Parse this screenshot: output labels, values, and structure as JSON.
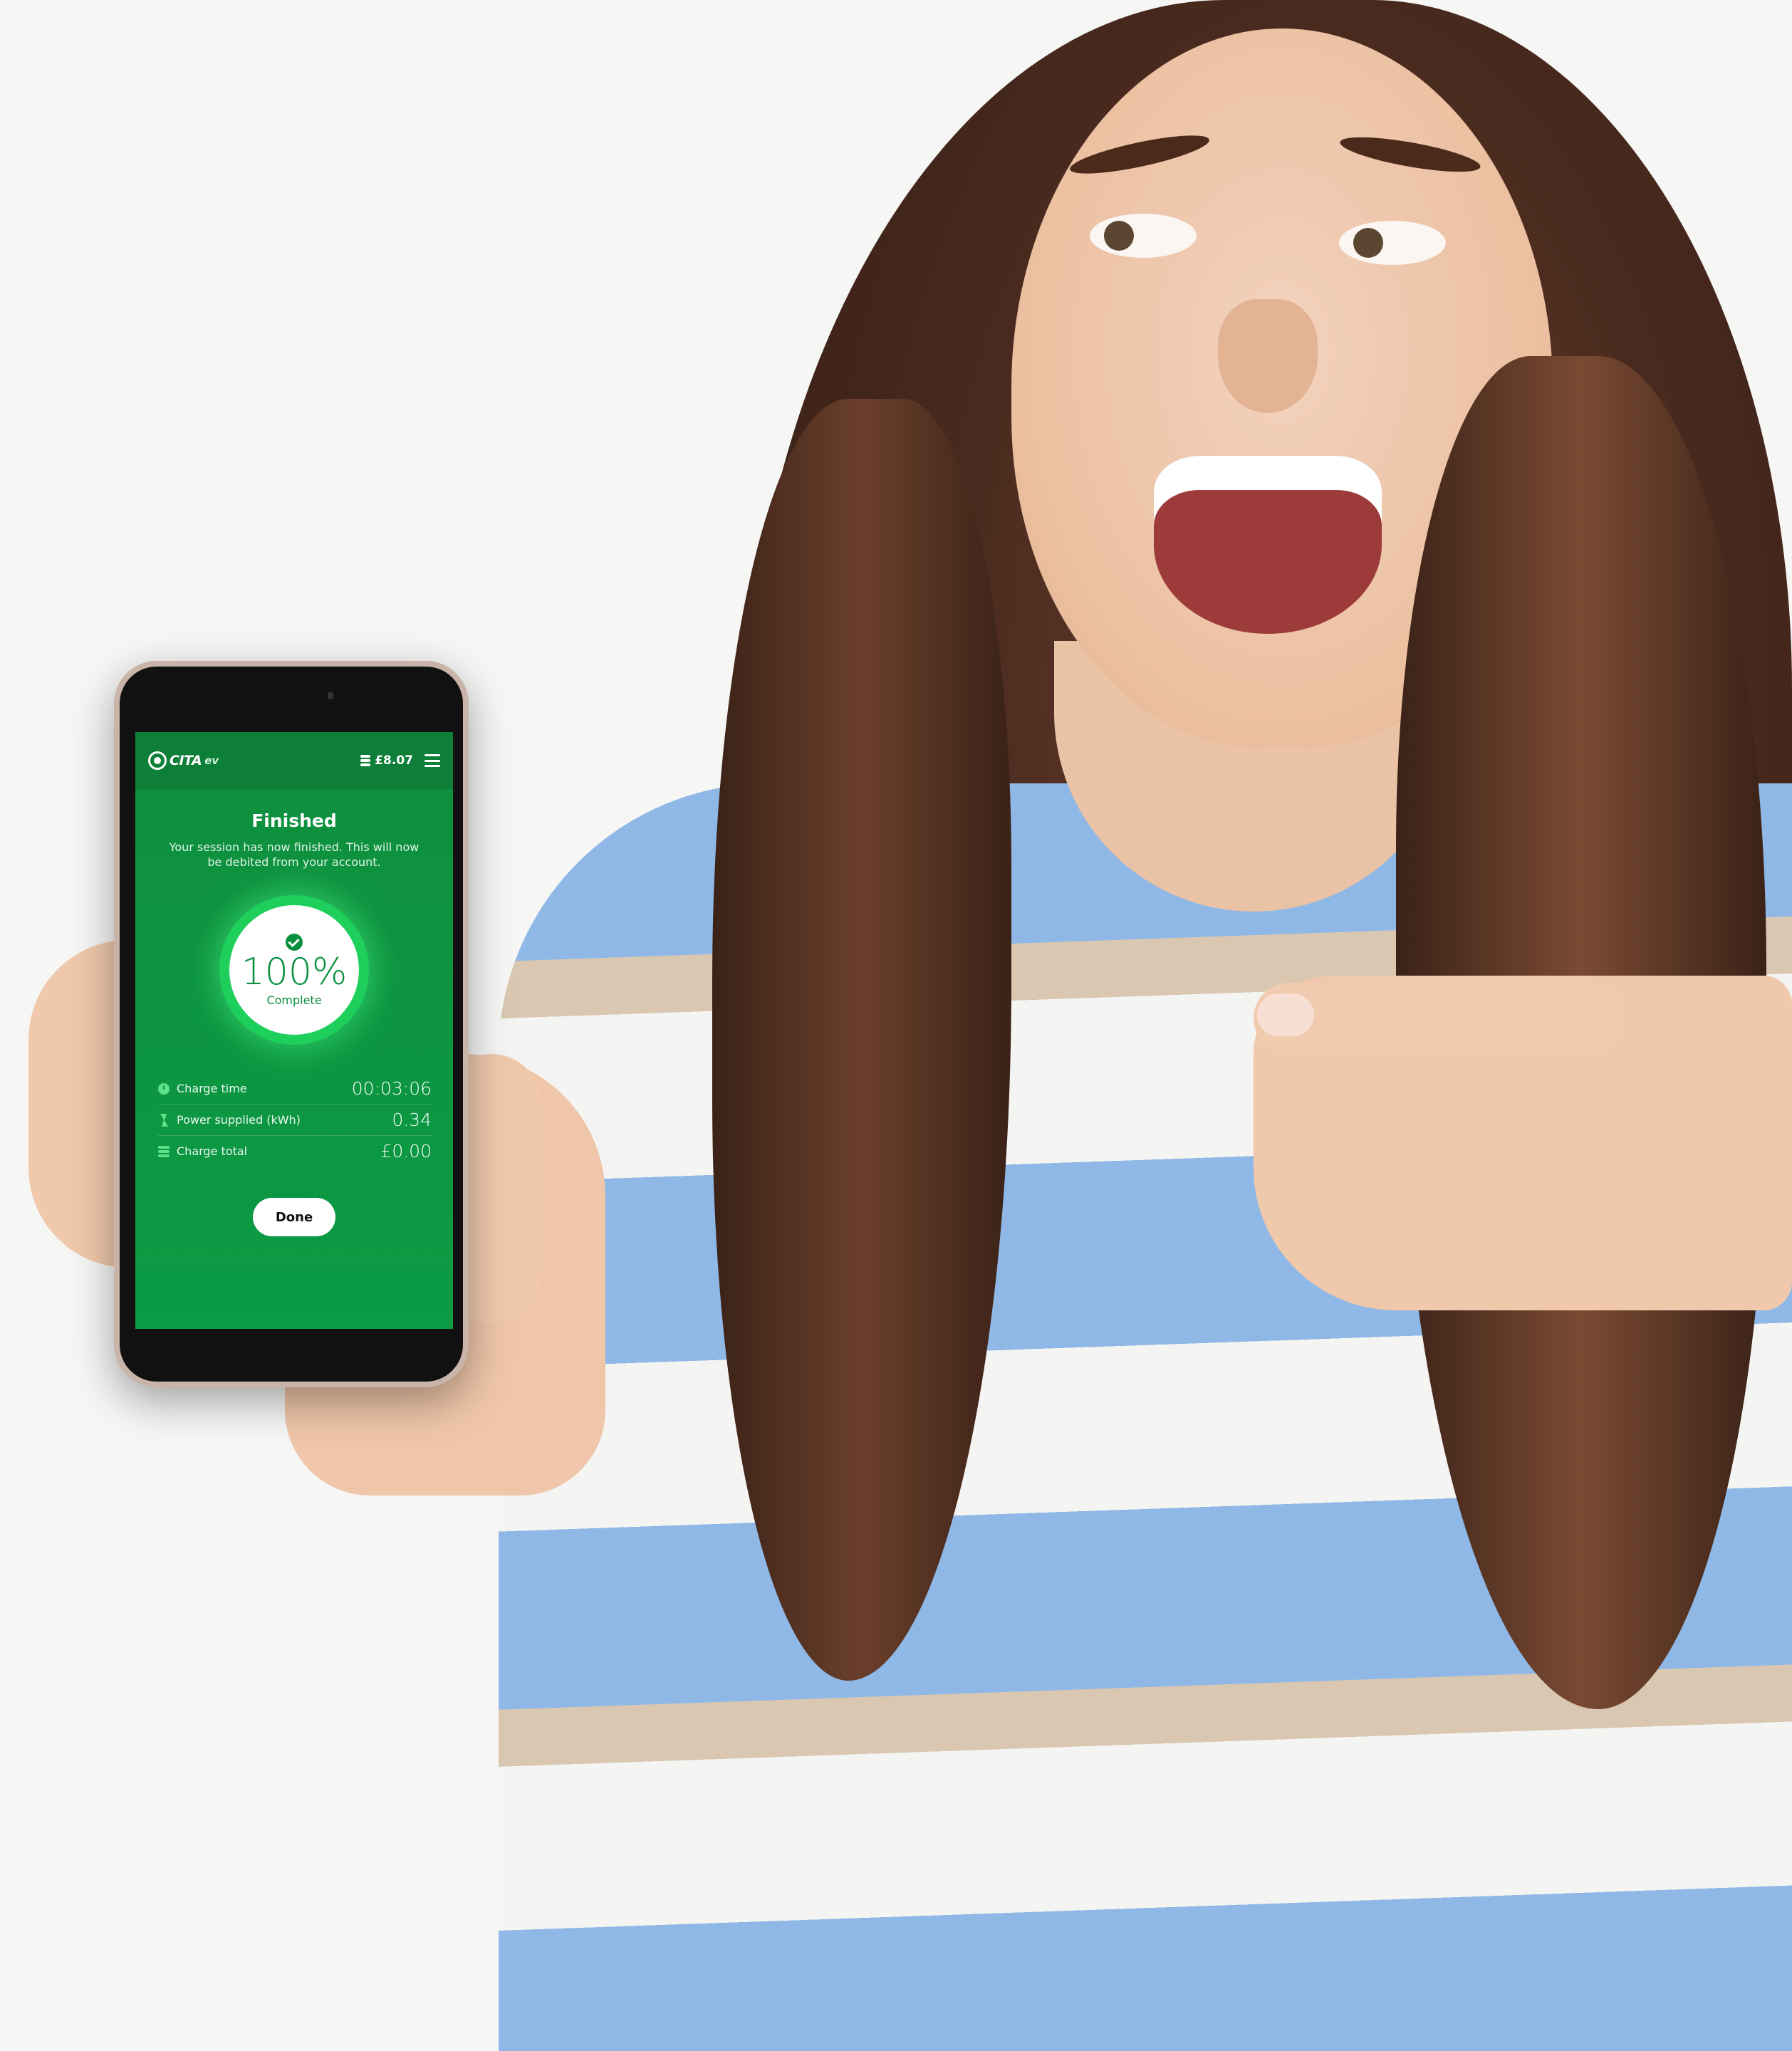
{
  "app": {
    "logo_text": "CITA",
    "logo_sub": "ev",
    "balance": "£8.07"
  },
  "session": {
    "title": "Finished",
    "message": "Your session has now finished. This will now be debited from your account.",
    "progress_percent": 100,
    "progress_label": "100%",
    "status": "Complete"
  },
  "stats": [
    {
      "label": "Charge time",
      "value": "00:03:06",
      "icon": "clock-icon"
    },
    {
      "label": "Power supplied (kWh)",
      "value": "0.34",
      "icon": "bolt-icon"
    },
    {
      "label": "Charge total",
      "value": "£0.00",
      "icon": "coins-icon"
    }
  ],
  "actions": {
    "done_label": "Done"
  },
  "colors": {
    "brand_green": "#0b9b44",
    "accent_green": "#1fcf5c",
    "topbar_green": "#0d7f39"
  }
}
